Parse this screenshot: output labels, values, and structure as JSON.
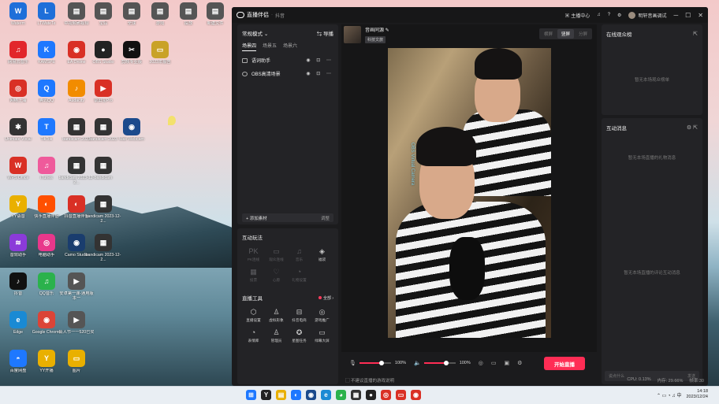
{
  "desktop": {
    "icons": [
      {
        "label": "Waterm",
        "color": "#1e6fd9",
        "glyph": "W",
        "col": 0,
        "row": 0
      },
      {
        "label": "LTWateTe",
        "color": "#1e6fd9",
        "glyph": "L",
        "col": 1,
        "row": 0
      },
      {
        "label": "中视频刷视频",
        "color": "#555",
        "glyph": "▤",
        "col": 2,
        "row": 0
      },
      {
        "label": "宝妈",
        "color": "#555",
        "glyph": "▤",
        "col": 3,
        "row": 0
      },
      {
        "label": "全球",
        "color": "#555",
        "glyph": "▤",
        "col": 4,
        "row": 0
      },
      {
        "label": "游戏",
        "color": "#555",
        "glyph": "▤",
        "col": 5,
        "row": 0
      },
      {
        "label": "投放",
        "color": "#555",
        "glyph": "▤",
        "col": 6,
        "row": 0
      },
      {
        "label": "新建文件",
        "color": "#555",
        "glyph": "▤",
        "col": 7,
        "row": 0
      },
      {
        "label": "网易云音乐",
        "color": "#e2262b",
        "glyph": "♫",
        "col": 0,
        "row": 1
      },
      {
        "label": "KAMSPE",
        "color": "#1e78ff",
        "glyph": "K",
        "col": 1,
        "row": 1
      },
      {
        "label": "EA Online",
        "color": "#d93025",
        "glyph": "◉",
        "col": 2,
        "row": 1
      },
      {
        "label": "OBS Studio",
        "color": "#222",
        "glyph": "●",
        "col": 3,
        "row": 1
      },
      {
        "label": "剪映专业版",
        "color": "#111",
        "glyph": "✂",
        "col": 4,
        "row": 1
      },
      {
        "label": "2023年报告",
        "color": "#c9a227",
        "glyph": "▭",
        "col": 5,
        "row": 1
      },
      {
        "label": "网络上海",
        "color": "#d93025",
        "glyph": "◎",
        "col": 0,
        "row": 2
      },
      {
        "label": "腾讯QQ",
        "color": "#1e78ff",
        "glyph": "Q",
        "col": 1,
        "row": 2
      },
      {
        "label": "Audacity",
        "color": "#f28c00",
        "glyph": "♪",
        "col": 2,
        "row": 2
      },
      {
        "label": "录屏宝Pro",
        "color": "#d93025",
        "glyph": "▶",
        "col": 3,
        "row": 2
      },
      {
        "label": "Unimate Vocal",
        "color": "#333",
        "glyph": "✱",
        "col": 0,
        "row": 3
      },
      {
        "label": "TikTok",
        "color": "#1e78ff",
        "glyph": "T",
        "col": 1,
        "row": 3
      },
      {
        "label": "bandicam 2023",
        "color": "#333",
        "glyph": "▦",
        "col": 2,
        "row": 3
      },
      {
        "label": "bandicam 2023",
        "color": "#333",
        "glyph": "▦",
        "col": 3,
        "row": 3
      },
      {
        "label": "Max Webcam",
        "color": "#1b4a8c",
        "glyph": "◉",
        "col": 4,
        "row": 3
      },
      {
        "label": "WPS Office",
        "color": "#d93025",
        "glyph": "W",
        "col": 0,
        "row": 4
      },
      {
        "label": "iTunes",
        "color": "#ef5a9b",
        "glyph": "♫",
        "col": 1,
        "row": 4
      },
      {
        "label": "bandicam 2023-12-2...",
        "color": "#333",
        "glyph": "▦",
        "col": 2,
        "row": 4
      },
      {
        "label": "bandicam",
        "color": "#333",
        "glyph": "▦",
        "col": 3,
        "row": 4
      },
      {
        "label": "YY语音",
        "color": "#e9b000",
        "glyph": "Y",
        "col": 0,
        "row": 5
      },
      {
        "label": "快手直播伴侣",
        "color": "#ff5000",
        "glyph": "◐",
        "col": 1,
        "row": 5
      },
      {
        "label": "抖音直播伴侣",
        "color": "#d93025",
        "glyph": "◐",
        "col": 2,
        "row": 5
      },
      {
        "label": "bandicam 2023-12-2...",
        "color": "#333",
        "glyph": "▦",
        "col": 3,
        "row": 5
      },
      {
        "label": "音效助手",
        "color": "#8b3bd9",
        "glyph": "≋",
        "col": 0,
        "row": 6
      },
      {
        "label": "电脑助手",
        "color": "#e8378b",
        "glyph": "◎",
        "col": 1,
        "row": 6
      },
      {
        "label": "Camo Studio",
        "color": "#1a3d6e",
        "glyph": "◉",
        "col": 2,
        "row": 6
      },
      {
        "label": "bandicam 2023-12-2...",
        "color": "#333",
        "glyph": "▦",
        "col": 3,
        "row": 6
      },
      {
        "label": "抖音",
        "color": "#111",
        "glyph": "♪",
        "col": 0,
        "row": 7
      },
      {
        "label": "QQ音乐",
        "color": "#2bb24c",
        "glyph": "♫",
        "col": 1,
        "row": 7
      },
      {
        "label": "安卓第一课-通用版本一",
        "color": "#555",
        "glyph": "▶",
        "col": 2,
        "row": 7
      },
      {
        "label": "Edge",
        "color": "#1a8ad4",
        "glyph": "e",
        "col": 0,
        "row": 8
      },
      {
        "label": "Google Chrome",
        "color": "#db4437",
        "glyph": "◉",
        "col": 1,
        "row": 8
      },
      {
        "label": "情人节一一520已买",
        "color": "#555",
        "glyph": "▶",
        "col": 2,
        "row": 8
      },
      {
        "label": "百度网盘",
        "color": "#1e78ff",
        "glyph": "◓",
        "col": 0,
        "row": 9
      },
      {
        "label": "YY开播",
        "color": "#e9b000",
        "glyph": "Y",
        "col": 1,
        "row": 9
      },
      {
        "label": "图片",
        "color": "#e9b000",
        "glyph": "▭",
        "col": 2,
        "row": 9
      }
    ]
  },
  "app": {
    "title": "直播伴侣",
    "sep": "·",
    "subtitle": "抖音",
    "user_center": "主播中心",
    "username": "明轩音画调试",
    "controls": {
      "minimize": "─",
      "maximize": "☐",
      "close": "✕"
    }
  },
  "scene": {
    "mode": "常规模式",
    "guide": "⇆ 导播",
    "tabs": [
      "场景四",
      "场景五",
      "场景六"
    ],
    "sources": [
      {
        "name": "语词助手"
      },
      {
        "name": "OBS高清场景"
      }
    ],
    "add_source": "+ 添加素材",
    "add_source_right": "调整"
  },
  "interact": {
    "title": "互动玩法",
    "tools": [
      {
        "icon": "PK",
        "label": "PK连线",
        "dim": true
      },
      {
        "icon": "▭",
        "label": "观众连线",
        "dim": true
      },
      {
        "icon": "♫",
        "label": "音乐",
        "dim": true
      },
      {
        "icon": "◈",
        "label": "福袋",
        "dim": false
      },
      {
        "icon": "▦",
        "label": "投票",
        "dim": true
      },
      {
        "icon": "♡",
        "label": "心愿",
        "dim": true
      },
      {
        "icon": "◔",
        "label": "礼物设置",
        "dim": true
      }
    ],
    "tools_title": "直播工具",
    "all_label": "全部 ›",
    "live_tools": [
      {
        "icon": "⬡",
        "label": "直播设置"
      },
      {
        "icon": "♙",
        "label": "虚拟形象"
      },
      {
        "icon": "⊟",
        "label": "抖音电商"
      },
      {
        "icon": "◎",
        "label": "游戏推广"
      },
      {
        "icon": "◔",
        "label": "表情库"
      },
      {
        "icon": "♙",
        "label": "管理员"
      },
      {
        "icon": "✪",
        "label": "星图任务"
      },
      {
        "icon": "▭",
        "label": "绿幕大屏"
      }
    ]
  },
  "preview": {
    "channel_title": "音画同源 ✎",
    "badge": "科技文旅",
    "orientations": [
      "横屏",
      "竖屏",
      "分屏"
    ],
    "active_orientation": 1,
    "overlay_text": "OBS Virtual Camera"
  },
  "controls": {
    "mic_volume": "100%",
    "mic_level": 0.7,
    "speaker_volume": "100%",
    "speaker_level": 0.7,
    "go_live": "开始直播"
  },
  "right": {
    "online_title": "在线观众榜",
    "online_empty": "暂无本场观众榜单",
    "interact_title": "互动消息",
    "gift_empty": "暂无本场直播的礼物消息",
    "comment_empty": "暂无本场直播的评论互动消息",
    "chat_placeholder": "说点什么",
    "chat_send": "发送"
  },
  "statusbar": {
    "hint": "▢ 不建议直播的游戏说明",
    "cpu": "CPU: 0.13%",
    "mem": "内存: 29.66%",
    "fps": "帧率:30"
  },
  "taskbar": {
    "icons": [
      {
        "glyph": "⊞",
        "color": "#1e78ff"
      },
      {
        "glyph": "Y",
        "color": "#222"
      },
      {
        "glyph": "▤",
        "color": "#e9b000"
      },
      {
        "glyph": "◐",
        "color": "#1e78ff"
      },
      {
        "glyph": "◉",
        "color": "#1b4a8c"
      },
      {
        "glyph": "e",
        "color": "#1a8ad4"
      },
      {
        "glyph": "◕",
        "color": "#2bb24c"
      },
      {
        "glyph": "▦",
        "color": "#333"
      },
      {
        "glyph": "●",
        "color": "#222"
      },
      {
        "glyph": "◎",
        "color": "#d93025"
      },
      {
        "glyph": "▭",
        "color": "#d93025"
      },
      {
        "glyph": "◉",
        "color": "#d93025"
      }
    ],
    "tray": "⌃ ▭ ◔ ♫ 中",
    "time": "14:18",
    "date": "2023/12/24"
  },
  "colors": {
    "accent": "#ff2d55",
    "bg": "#1b1b1d",
    "panel": "#232326"
  }
}
